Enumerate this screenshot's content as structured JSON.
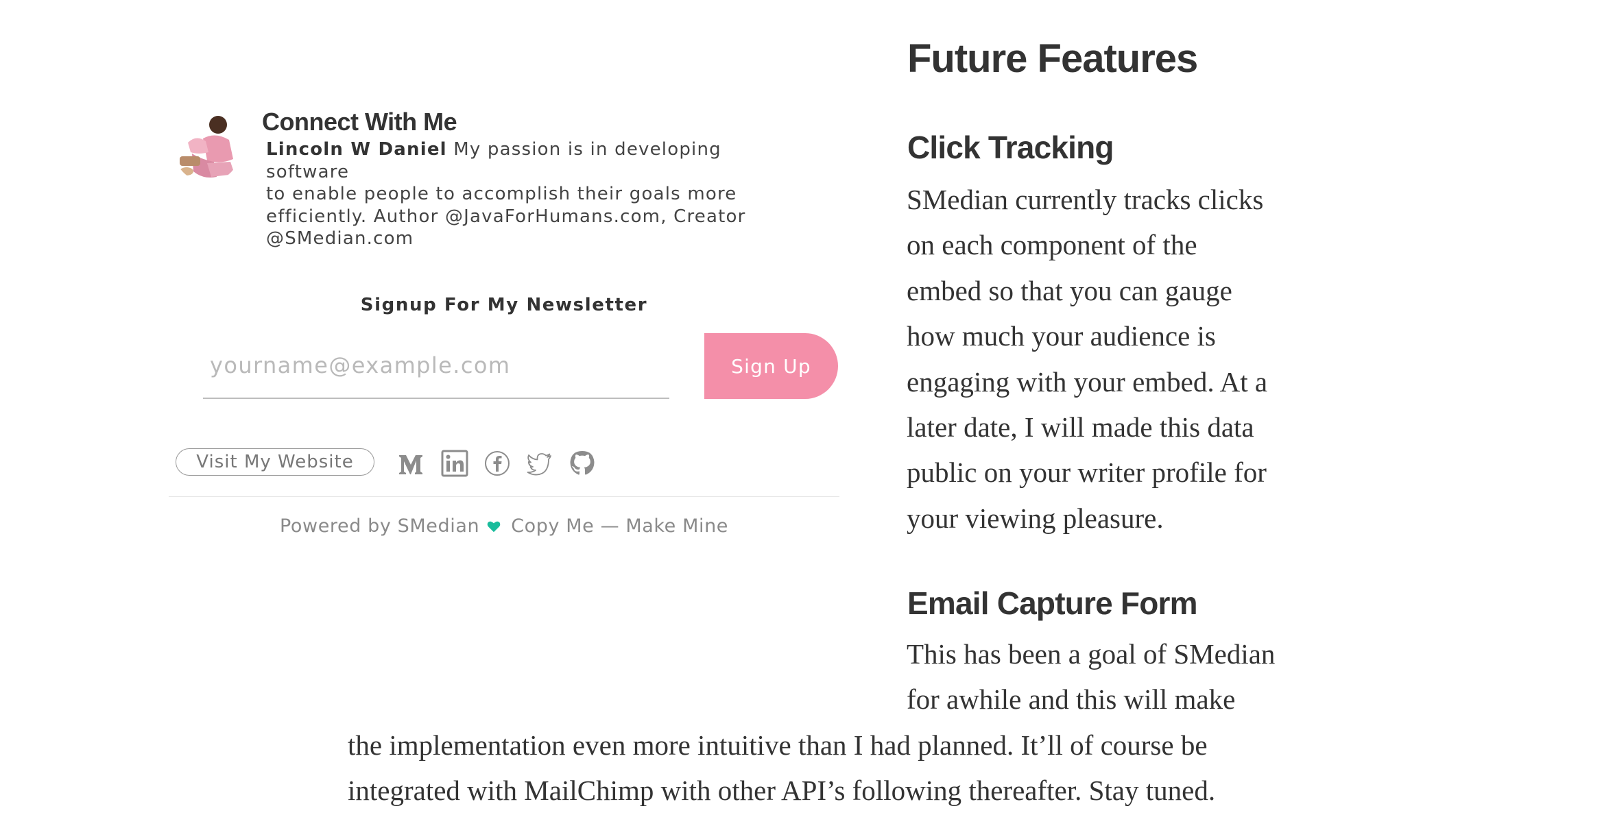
{
  "embed": {
    "connect_title": "Connect With Me",
    "author_name": "Lincoln W Daniel",
    "bio_line1_rest": " My passion is in developing software",
    "bio_line2": "to enable people to accomplish their goals more",
    "bio_line3": "efficiently. Author @JavaForHumans.com, Creator",
    "bio_line4": "@SMedian.com",
    "newsletter_title": "Signup For My Newsletter",
    "email_placeholder": "yourname@example.com",
    "email_value": "",
    "signup_label": "Sign Up",
    "visit_website_label": "Visit My Website",
    "social_icons": [
      "medium-icon",
      "linkedin-icon",
      "facebook-icon",
      "twitter-icon",
      "github-icon"
    ],
    "footer": {
      "powered_by": "Powered by SMedian",
      "copy_me": "Copy Me — Make Mine",
      "heart_icon": "heart-icon"
    },
    "colors": {
      "signup_button": "#f48fa9",
      "heart": "#1abc9c",
      "social_icons": "#8c8c8c"
    }
  },
  "article": {
    "title": "Future Features",
    "sections": [
      {
        "heading": "Click Tracking",
        "lines": [
          "SMedian currently tracks clicks",
          "on each component of the",
          "embed so that you can gauge",
          "how much your audience is",
          "engaging with your embed. At a",
          "later date, I will made this data",
          "public on your writer profile for",
          "your viewing pleasure."
        ]
      },
      {
        "heading": "Email Capture Form",
        "lines": [
          "This has been a goal of SMedian",
          "for awhile and this will make",
          "the implementation even more intuitive than I had planned. It’ll of course be",
          "integrated with MailChimp with other API’s following thereafter. Stay tuned."
        ]
      }
    ]
  }
}
